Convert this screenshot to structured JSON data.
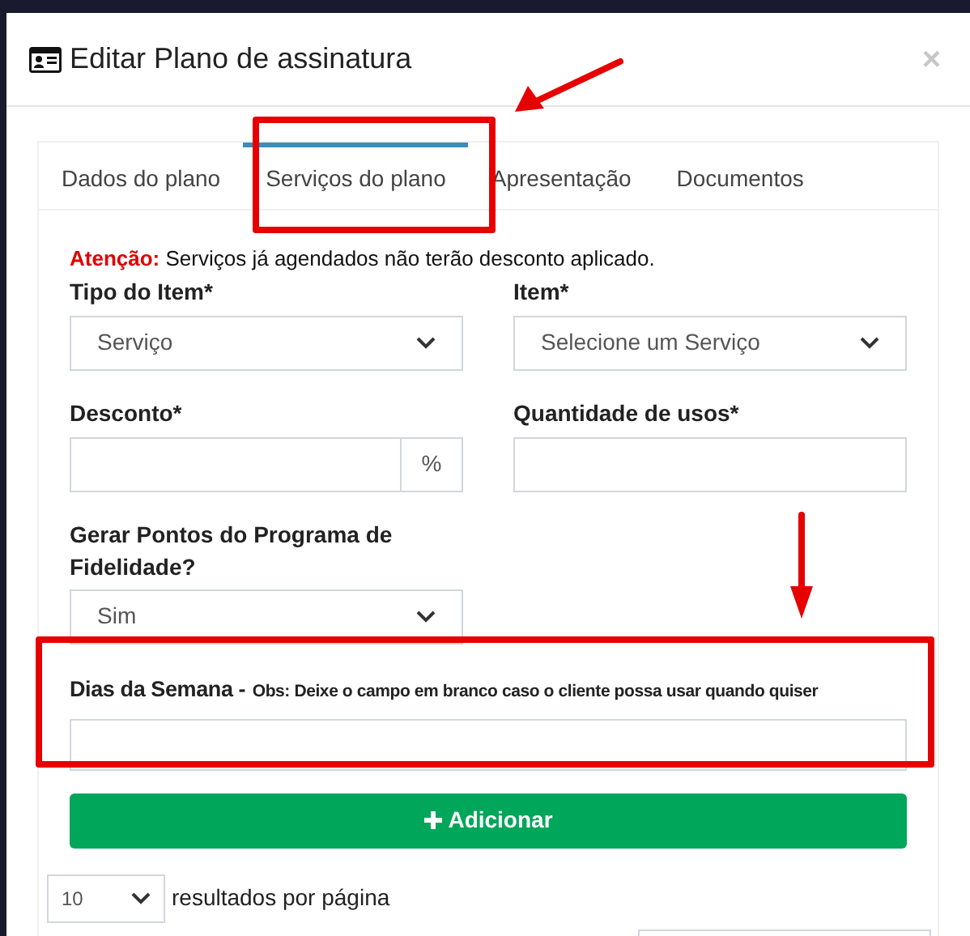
{
  "modal": {
    "title": "Editar Plano de assinatura",
    "close": "×"
  },
  "tabs": [
    {
      "label": "Dados do plano",
      "selected": false
    },
    {
      "label": "Serviços do plano",
      "selected": true
    },
    {
      "label": "Apresentação",
      "selected": false
    },
    {
      "label": "Documentos",
      "selected": false
    }
  ],
  "notice": {
    "prefix": "Atenção:",
    "text": "Serviços já agendados não terão desconto aplicado."
  },
  "fields": {
    "item_type": {
      "label": "Tipo do Item*",
      "value": "Serviço"
    },
    "item": {
      "label": "Item*",
      "value": "Selecione um Serviço"
    },
    "discount": {
      "label": "Desconto*",
      "suffix": "%"
    },
    "uses": {
      "label": "Quantidade de usos*"
    },
    "points": {
      "label": "Gerar Pontos do Programa de Fidelidade?",
      "value": "Sim"
    },
    "weekdays": {
      "label": "Dias da Semana -",
      "note": "Obs: Deixe o campo em branco caso o cliente possa usar quando quiser"
    }
  },
  "add_button": {
    "label": "Adicionar"
  },
  "page_size": {
    "value": "10",
    "label": "resultados por página"
  }
}
